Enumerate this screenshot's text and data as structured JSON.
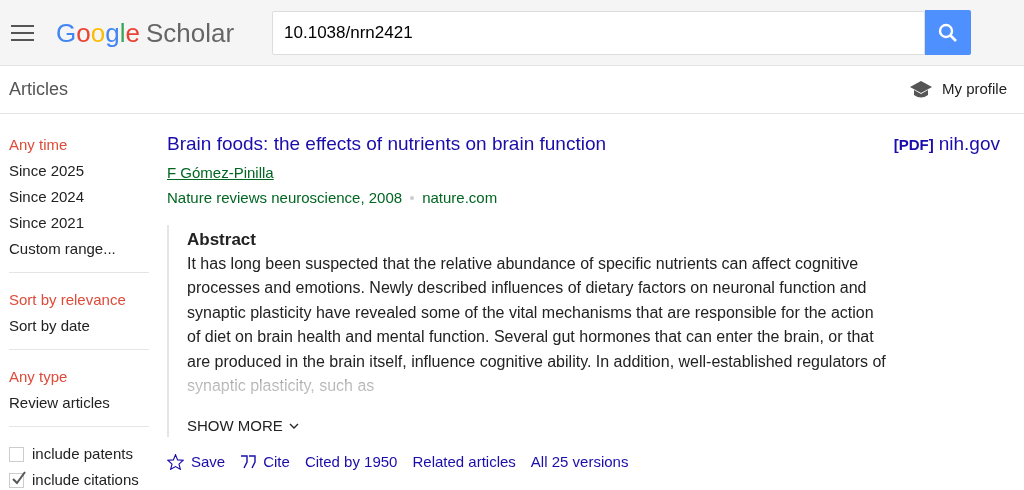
{
  "header": {
    "logo_brand": "Google",
    "logo_product": "Scholar",
    "search": {
      "value": "10.1038/nrn2421"
    }
  },
  "subbar": {
    "title": "Articles",
    "profile": "My profile"
  },
  "sidebar": {
    "groups": [
      {
        "items": [
          {
            "label": "Any time",
            "selected": true
          },
          {
            "label": "Since 2025",
            "selected": false
          },
          {
            "label": "Since 2024",
            "selected": false
          },
          {
            "label": "Since 2021",
            "selected": false
          },
          {
            "label": "Custom range...",
            "selected": false
          }
        ]
      },
      {
        "items": [
          {
            "label": "Sort by relevance",
            "selected": true
          },
          {
            "label": "Sort by date",
            "selected": false
          }
        ]
      },
      {
        "items": [
          {
            "label": "Any type",
            "selected": true
          },
          {
            "label": "Review articles",
            "selected": false
          }
        ]
      }
    ],
    "checkboxes": [
      {
        "label": "include patents",
        "checked": false
      },
      {
        "label": "include citations",
        "checked": true
      }
    ]
  },
  "result": {
    "title": "Brain foods: the effects of nutrients on brain function",
    "pdf_tag": "[PDF]",
    "pdf_source": "nih.gov",
    "author": "F Gómez-Pinilla",
    "venue": "Nature reviews neuroscience, 2008",
    "site": "nature.com",
    "abstract_heading": "Abstract",
    "abstract": "It has long been suspected that the relative abundance of specific nutrients can affect cognitive processes and emotions. Newly described influences of dietary factors on neuronal function and synaptic plasticity have revealed some of the vital mechanisms that are responsible for the action of diet on brain health and mental function. Several gut hormones that can enter the brain, or that are produced in the brain itself, influence cognitive ability. In addition, well-established regulators of synaptic plasticity, such as",
    "show_more": "SHOW MORE",
    "actions": [
      {
        "kind": "save",
        "label": "Save"
      },
      {
        "kind": "cite",
        "label": "Cite"
      },
      {
        "kind": "link",
        "label": "Cited by 1950"
      },
      {
        "kind": "link",
        "label": "Related articles"
      },
      {
        "kind": "link",
        "label": "All 25 versions"
      }
    ]
  }
}
